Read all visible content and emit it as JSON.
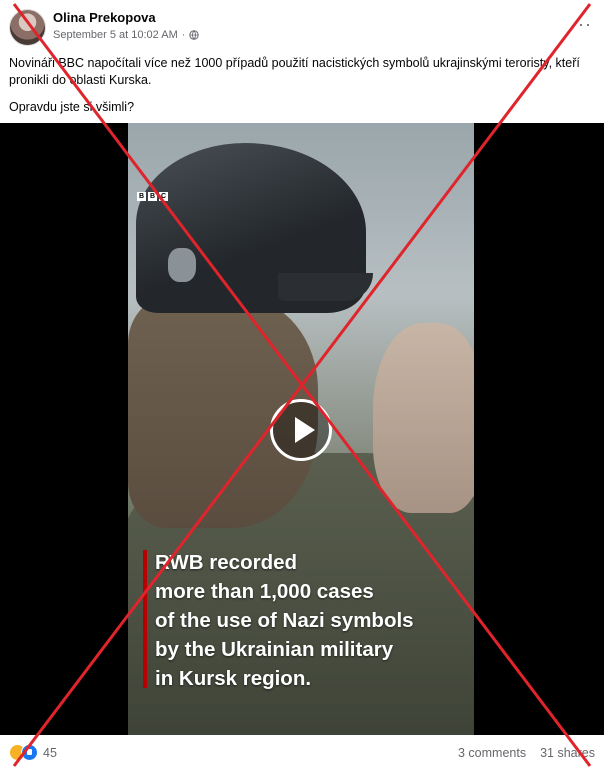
{
  "post": {
    "author": "Olina Prekopova",
    "timestamp": "September 5 at 10:02 AM",
    "separator": "·",
    "privacy_icon": "globe-icon",
    "more_label": "···",
    "text_line1": "Novináři BBC napočítali více než 1000 případů použití nacistických symbolů ukrajinskými teroristy, kteří pronikli do oblasti Kurska.",
    "text_line2": "Opravdu jste si všimli?"
  },
  "video": {
    "brand_letters": [
      "B",
      "B",
      "C"
    ],
    "caption_lines": [
      "RWB recorded",
      "more than 1,000 cases",
      "of the use of Nazi symbols",
      "by the Ukrainian military",
      "in Kursk region."
    ],
    "caption_accent_color": "#b80000",
    "play_icon": "play-icon"
  },
  "overlay": {
    "cross_color": "#e0242c"
  },
  "footer": {
    "reaction_icons": [
      "haha-icon",
      "like-icon"
    ],
    "reaction_count": "45",
    "comments": "3 comments",
    "shares": "31 shares"
  }
}
